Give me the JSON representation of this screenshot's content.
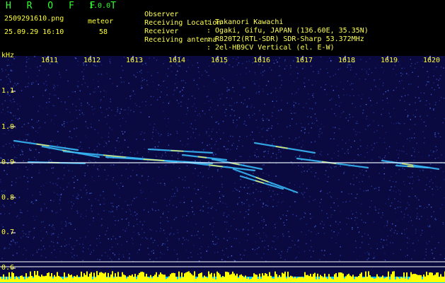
{
  "app": {
    "name": "H R O F F T",
    "version": "1.0.0"
  },
  "capture": {
    "filename": "2509291610.png",
    "datetime": "25.09.29 16:10"
  },
  "meteor": {
    "label": "meteor",
    "count": "58"
  },
  "info_rows": [
    {
      "label": "Observer",
      "value": ": Takanori Kawachi"
    },
    {
      "label": "Receiving Location",
      "value": ": Ogaki, Gifu, JAPAN (136.60E, 35.35N)"
    },
    {
      "label": "Receiver",
      "value": ": R820T2(RTL-SDR) SDR-Sharp 53.372MHz"
    },
    {
      "label": "Receiving antenna",
      "value": ": 2el-HB9CV Vertical (el. E-W)"
    }
  ],
  "spectrogram": {
    "unit_label": "kHz",
    "x_ticks": [
      "1611",
      "1612",
      "1613",
      "1614",
      "1615",
      "1616",
      "1617",
      "1618",
      "1619",
      "1620"
    ],
    "y_ticks": [
      "1.1",
      "1.0",
      "0.9",
      "0.8",
      "0.7",
      "0.6"
    ],
    "colors": {
      "background": "#0a0a40",
      "carrier": "#ffffff",
      "echo": "#4aa8ff",
      "level_bar": "#ffff00",
      "level_base": "#00c0ff",
      "text": "#ffff33"
    }
  }
}
